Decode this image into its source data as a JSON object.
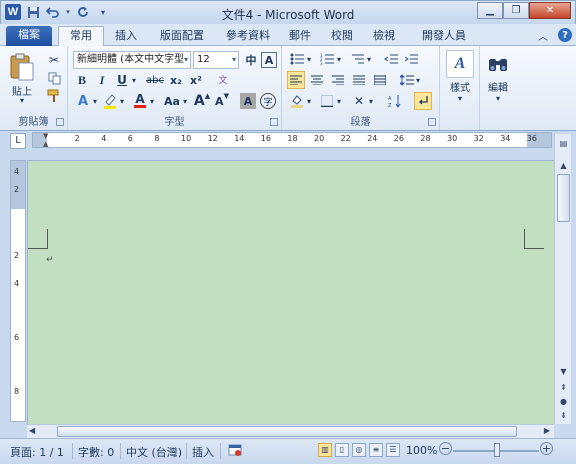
{
  "app": {
    "window_title": "文件4 - Microsoft Word",
    "word_icon": "W",
    "qat": [
      "save-icon",
      "undo-icon",
      "redo-icon",
      "customize-qat-icon"
    ]
  },
  "tabs": {
    "file": "檔案",
    "home": "常用",
    "insert": "插入",
    "page_layout": "版面配置",
    "references": "參考資料",
    "mailings": "郵件",
    "review": "校閱",
    "view": "檢視",
    "developer": "開發人員"
  },
  "ribbon": {
    "clipboard": {
      "label": "剪貼簿",
      "paste": "貼上"
    },
    "font": {
      "label": "字型",
      "font_name": "新細明體 (本文中文字型",
      "font_size": "12",
      "bold": "B",
      "italic": "I",
      "underline": "U",
      "strikethrough": "abc",
      "subscript": "x₂",
      "superscript": "x²",
      "grow": "A",
      "shrink": "A",
      "change_case": "Aa",
      "font_color": "A",
      "char_shading": "A",
      "phonetic": "文",
      "border": "A",
      "enclose": "字"
    },
    "paragraph": {
      "label": "段落"
    },
    "styles": {
      "label": "樣式"
    },
    "editing": {
      "label": "編輯"
    }
  },
  "ruler": {
    "tab_selector": "L",
    "h_numbers": [
      "2",
      "4",
      "6",
      "8",
      "10",
      "12",
      "14",
      "16",
      "18",
      "20",
      "22",
      "24",
      "26",
      "28",
      "30",
      "32",
      "34",
      "36"
    ],
    "v_numbers": [
      "4",
      "2",
      "2",
      "4",
      "6",
      "8"
    ]
  },
  "document": {
    "paragraph_mark": "↵",
    "background": "#c2dfc2"
  },
  "statusbar": {
    "page": "頁面: 1 / 1",
    "words": "字數: 0",
    "language": "中文 (台灣)",
    "mode": "插入",
    "zoom": "100%",
    "zoom_out": "−",
    "zoom_in": "+"
  }
}
